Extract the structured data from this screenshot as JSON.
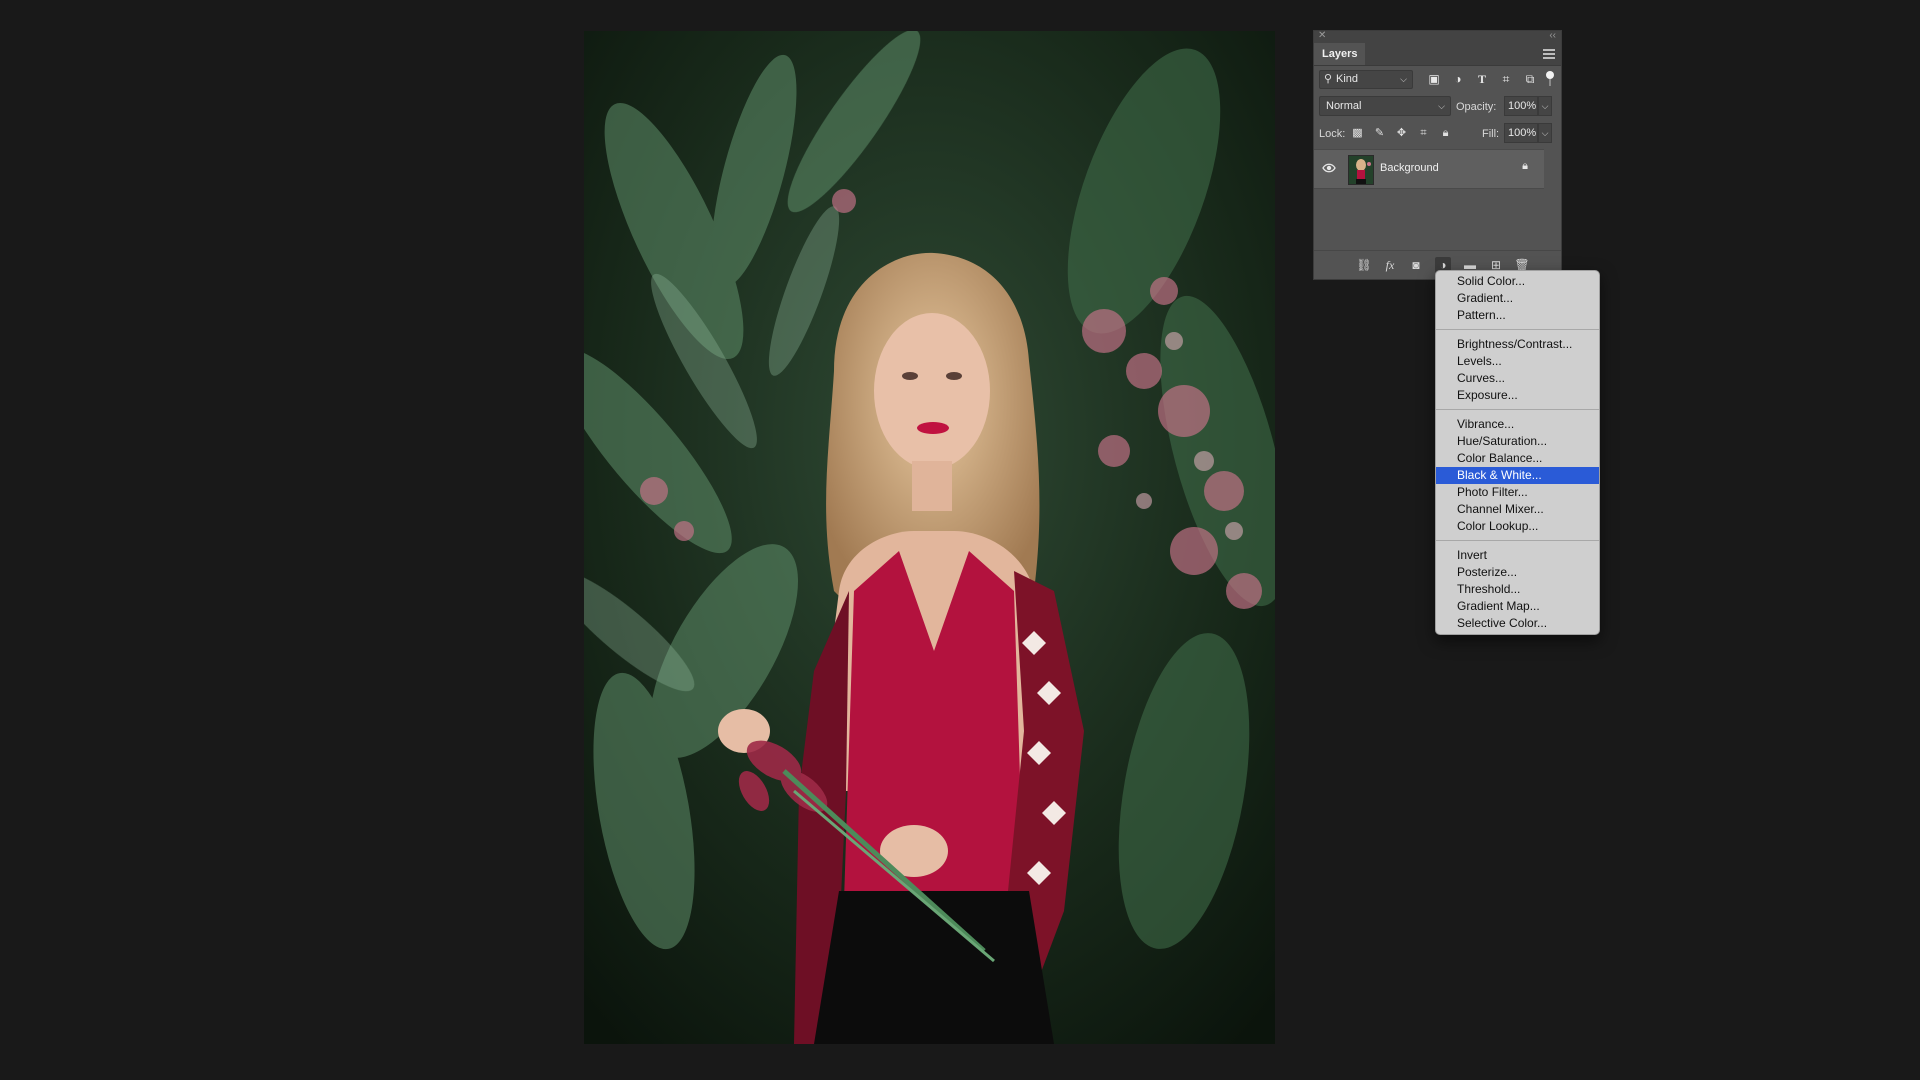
{
  "canvas": {
    "subject": "photo"
  },
  "layers_panel": {
    "tab_label": "Layers",
    "filter": {
      "kind_label": "Kind",
      "filter_icons": [
        "image-filter-icon",
        "adjustment-filter-icon",
        "type-filter-icon",
        "shape-filter-icon",
        "smart-object-filter-icon"
      ]
    },
    "blend_mode": "Normal",
    "opacity_label": "Opacity:",
    "opacity_value": "100%",
    "lock_label": "Lock:",
    "fill_label": "Fill:",
    "fill_value": "100%",
    "layers": [
      {
        "name": "Background",
        "visible": true,
        "locked": true
      }
    ],
    "footer_icons": [
      "link-icon",
      "fx-icon",
      "mask-icon",
      "adjustment-icon",
      "folder-icon",
      "new-layer-icon",
      "trash-icon"
    ],
    "fx_label": "fx"
  },
  "adjustment_menu": {
    "groups": [
      [
        "Solid Color...",
        "Gradient...",
        "Pattern..."
      ],
      [
        "Brightness/Contrast...",
        "Levels...",
        "Curves...",
        "Exposure..."
      ],
      [
        "Vibrance...",
        "Hue/Saturation...",
        "Color Balance...",
        "Black & White...",
        "Photo Filter...",
        "Channel Mixer...",
        "Color Lookup..."
      ],
      [
        "Invert",
        "Posterize...",
        "Threshold...",
        "Gradient Map...",
        "Selective Color..."
      ]
    ],
    "highlighted": "Black & White...",
    "highlight_color": "#2a5bd7"
  }
}
